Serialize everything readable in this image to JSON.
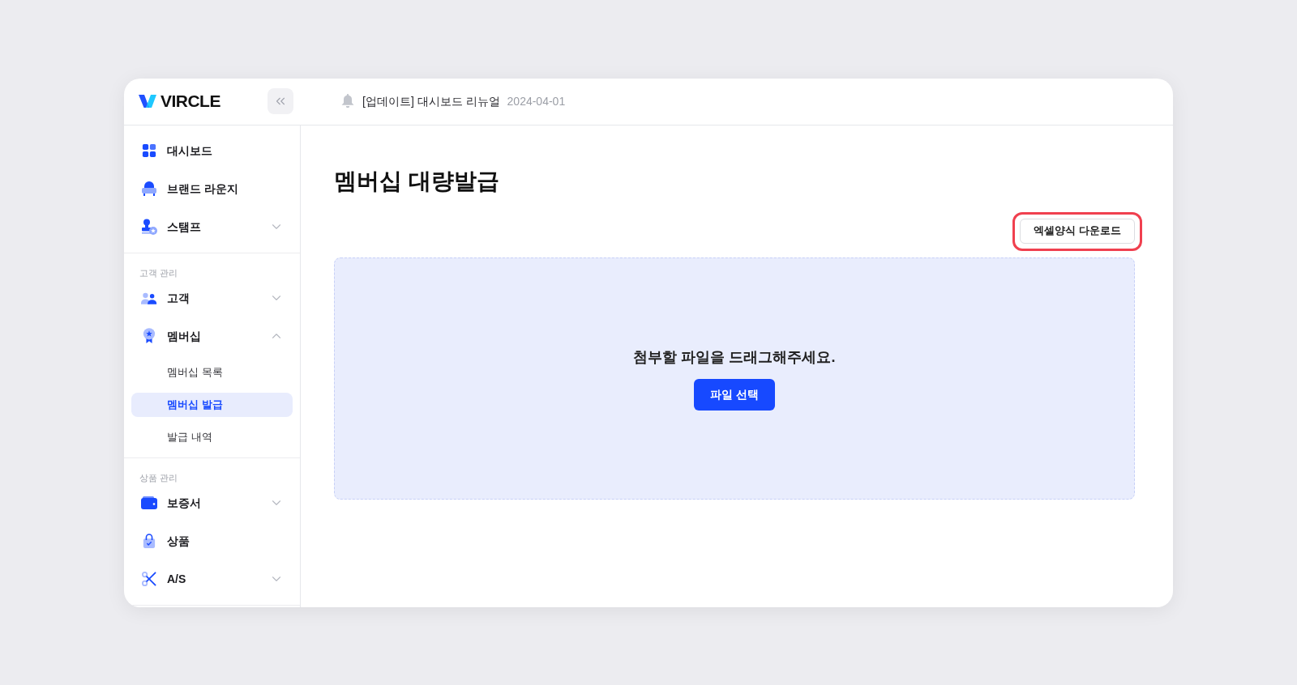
{
  "brand": {
    "name": "VIRCLE"
  },
  "header": {
    "notice": {
      "text": "[업데이트] 대시보드 리뉴얼",
      "date": "2024-04-01"
    }
  },
  "sidebar": {
    "sections": [
      {
        "items": [
          {
            "label": "대시보드",
            "selected": false
          },
          {
            "label": "브랜드 라운지",
            "selected": false
          },
          {
            "label": "스탬프",
            "selected": false,
            "expanded": false
          }
        ]
      },
      {
        "label": "고객 관리",
        "items": [
          {
            "label": "고객",
            "selected": false,
            "expanded": false
          },
          {
            "label": "멤버십",
            "selected": false,
            "expanded": true,
            "children": [
              {
                "label": "멤버십 목록",
                "selected": false
              },
              {
                "label": "멤버십 발급",
                "selected": true
              },
              {
                "label": "발급 내역",
                "selected": false
              }
            ]
          }
        ]
      },
      {
        "label": "상품 관리",
        "items": [
          {
            "label": "보증서",
            "selected": false,
            "expanded": false
          },
          {
            "label": "상품",
            "selected": false
          },
          {
            "label": "A/S",
            "selected": false,
            "expanded": false
          }
        ]
      }
    ]
  },
  "main": {
    "title": "멤버십 대량발급",
    "download_button": {
      "label": "엑셀양식 다운로드",
      "highlighted": true
    },
    "dropzone": {
      "message": "첨부할 파일을 드래그해주세요.",
      "button": "파일 선택"
    }
  }
}
